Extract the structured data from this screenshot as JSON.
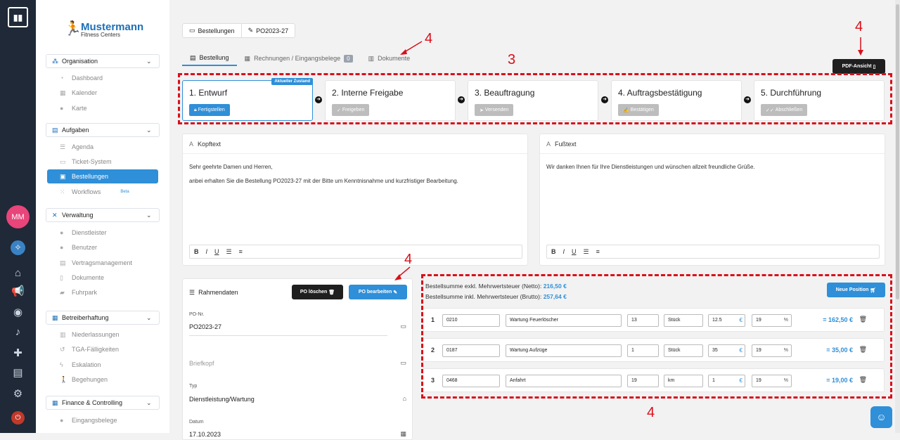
{
  "brand": {
    "name": "Mustermann",
    "sub": "Fitness Centers"
  },
  "rail": {
    "avatar": "MM"
  },
  "sidebar": {
    "sections": [
      {
        "label": "Organisation",
        "items": [
          "Dashboard",
          "Kalender",
          "Karte"
        ]
      },
      {
        "label": "Aufgaben",
        "items": [
          "Agenda",
          "Ticket-System",
          "Bestellungen",
          "Workflows"
        ]
      },
      {
        "label": "Verwaltung",
        "items": [
          "Dienstleister",
          "Benutzer",
          "Vertragsmanagement",
          "Dokumente",
          "Fuhrpark"
        ]
      },
      {
        "label": "Betreiberhaftung",
        "items": [
          "Niederlassungen",
          "TGA-Fälligkeiten",
          "Eskalation",
          "Begehungen"
        ]
      },
      {
        "label": "Finance & Controlling",
        "items": [
          "Eingangsbelege"
        ]
      }
    ],
    "beta": "Beta"
  },
  "breadcrumb": [
    "Bestellungen",
    "PO2023-27"
  ],
  "tabs": {
    "bestellung": "Bestellung",
    "rechnungen": "Rechnungen / Eingangsbelege",
    "rechnungen_count": "0",
    "dokumente": "Dokumente"
  },
  "pdf_button": "PDF-Ansicht",
  "steps": [
    {
      "title": "1. Entwurf",
      "button": "Fertigstellen",
      "badge": "Aktueller Zustand"
    },
    {
      "title": "2. Interne Freigabe",
      "button": "Freigeben"
    },
    {
      "title": "3. Beauftragung",
      "button": "Versenden"
    },
    {
      "title": "4. Auftragsbestätigung",
      "button": "Bestätigen"
    },
    {
      "title": "5. Durchführung",
      "button": "Abschließen"
    }
  ],
  "kopftext": {
    "title": "Kopftext",
    "line1": "Sehr geehrte Damen und Herren,",
    "line2": "anbei erhalten Sie die Bestellung PO2023-27 mit der Bitte um Kenntnisnahme und kurzfristiger Bearbeitung."
  },
  "fusstext": {
    "title": "Fußtext",
    "line1": "Wir danken Ihnen für Ihre Dienstleistungen und wünschen allzeit freundliche Grüße."
  },
  "toolbar": {
    "bold": "B",
    "italic": "I",
    "underline": "U"
  },
  "rahmendaten": {
    "title": "Rahmendaten",
    "delete": "PO löschen",
    "edit": "PO bearbeiten",
    "po_label": "PO-Nr.",
    "po_value": "PO2023-27",
    "briefkopf": "Briefkopf",
    "typ_label": "Typ",
    "typ_value": "Dienstleistung/Wartung",
    "datum_label": "Datum",
    "datum_value": "17.10.2023"
  },
  "sums": {
    "netto_label": "Bestellsumme exkl. Mehrwertsteuer (Netto):",
    "netto": "216,50 €",
    "brutto_label": "Bestellsumme inkl. Mehrwertsteuer (Brutto):",
    "brutto": "257,64 €"
  },
  "neue_position": "Neue Position",
  "positions": [
    {
      "nr": "1",
      "code": "0210",
      "desc": "Wartung Feuerlöscher",
      "qty": "13",
      "unit": "Stück",
      "price": "12.5",
      "tax": "19",
      "total": "= 162,50 €"
    },
    {
      "nr": "2",
      "code": "0187",
      "desc": "Wartung Aufzüge",
      "qty": "1",
      "unit": "Stück",
      "price": "35",
      "tax": "19",
      "total": "= 35,00 €"
    },
    {
      "nr": "3",
      "code": "0468",
      "desc": "Anfahrt",
      "qty": "19",
      "unit": "km",
      "price": "1",
      "tax": "19",
      "total": "= 19,00 €"
    }
  ],
  "annotations": {
    "a1": "4",
    "a2": "4",
    "a3": "3",
    "a4": "4",
    "a5": "4"
  },
  "colors": {
    "accent": "#2f8fd8",
    "annotation": "#d90f1a",
    "rail": "#1f2937"
  }
}
